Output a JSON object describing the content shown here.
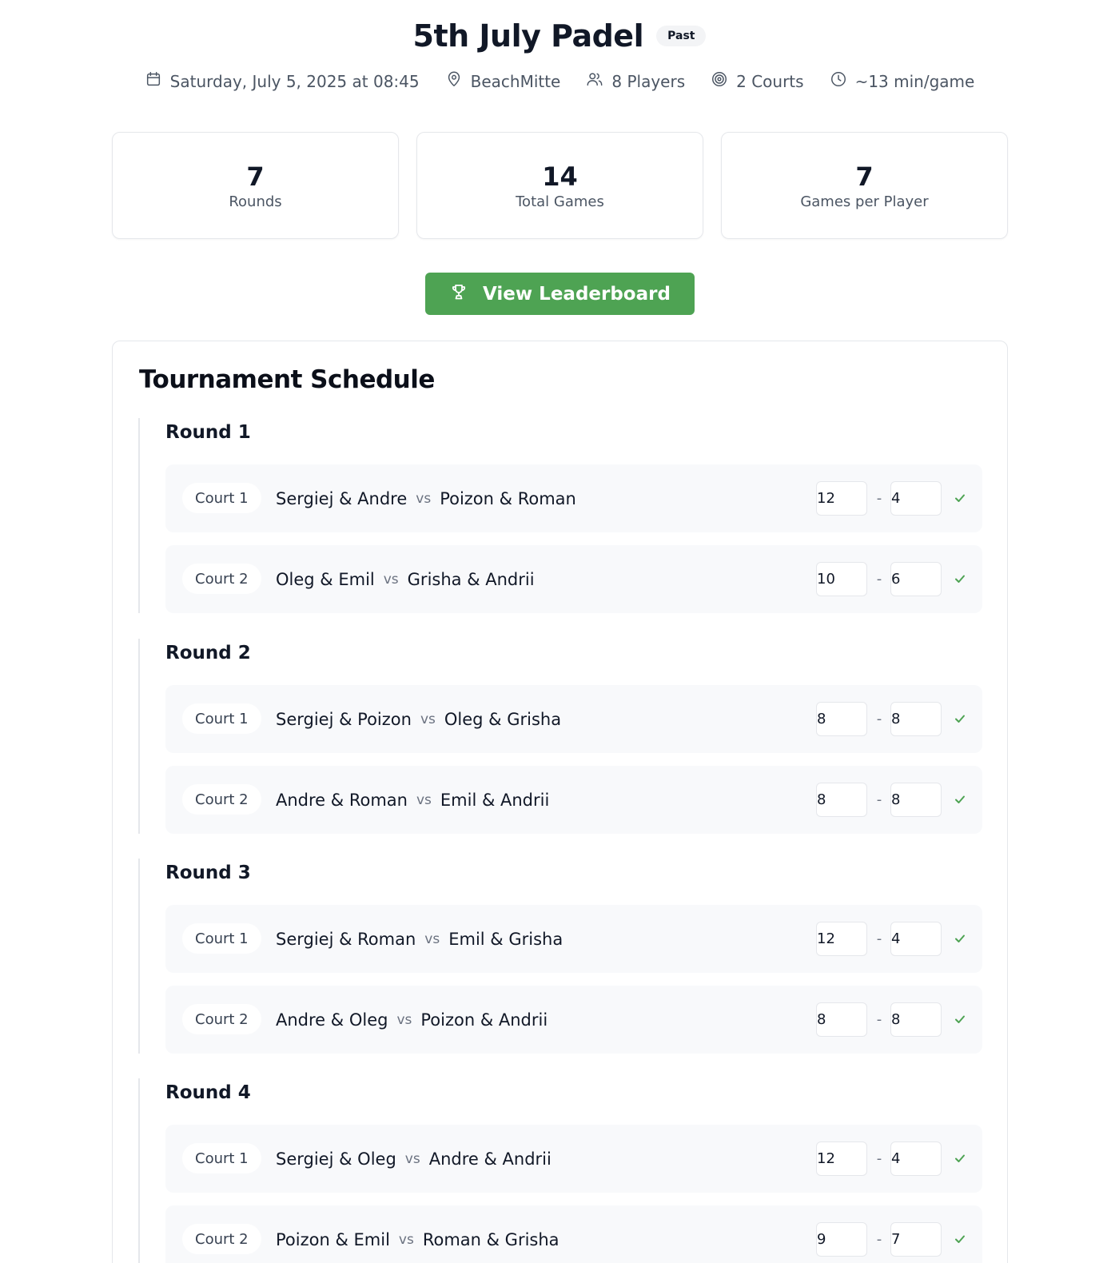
{
  "event": {
    "title": "5th July Padel",
    "status_badge": "Past",
    "date": "Saturday, July 5, 2025 at 08:45",
    "location": "BeachMitte",
    "players": "8 Players",
    "courts": "2 Courts",
    "duration": "~13 min/game"
  },
  "stats": [
    {
      "value": "7",
      "label": "Rounds"
    },
    {
      "value": "14",
      "label": "Total Games"
    },
    {
      "value": "7",
      "label": "Games per Player"
    }
  ],
  "leaderboard_button": "View Leaderboard",
  "schedule": {
    "title": "Tournament Schedule",
    "vs_label": "vs",
    "score_separator": "-",
    "rounds": [
      {
        "title": "Round 1",
        "matches": [
          {
            "court": "Court 1",
            "team_a": "Sergiej & Andre",
            "team_b": "Poizon & Roman",
            "score_a": "12",
            "score_b": "4"
          },
          {
            "court": "Court 2",
            "team_a": "Oleg & Emil",
            "team_b": "Grisha & Andrii",
            "score_a": "10",
            "score_b": "6"
          }
        ]
      },
      {
        "title": "Round 2",
        "matches": [
          {
            "court": "Court 1",
            "team_a": "Sergiej & Poizon",
            "team_b": "Oleg & Grisha",
            "score_a": "8",
            "score_b": "8"
          },
          {
            "court": "Court 2",
            "team_a": "Andre & Roman",
            "team_b": "Emil & Andrii",
            "score_a": "8",
            "score_b": "8"
          }
        ]
      },
      {
        "title": "Round 3",
        "matches": [
          {
            "court": "Court 1",
            "team_a": "Sergiej & Roman",
            "team_b": "Emil & Grisha",
            "score_a": "12",
            "score_b": "4"
          },
          {
            "court": "Court 2",
            "team_a": "Andre & Oleg",
            "team_b": "Poizon & Andrii",
            "score_a": "8",
            "score_b": "8"
          }
        ]
      },
      {
        "title": "Round 4",
        "matches": [
          {
            "court": "Court 1",
            "team_a": "Sergiej & Oleg",
            "team_b": "Andre & Andrii",
            "score_a": "12",
            "score_b": "4"
          },
          {
            "court": "Court 2",
            "team_a": "Poizon & Emil",
            "team_b": "Roman & Grisha",
            "score_a": "9",
            "score_b": "7"
          }
        ]
      }
    ]
  },
  "colors": {
    "accent_green": "#4ea353",
    "match_bg": "#f8f9fb",
    "border": "#e5e7eb"
  },
  "icons": [
    "calendar-icon",
    "location-pin-icon",
    "users-icon",
    "target-icon",
    "clock-icon",
    "trophy-icon",
    "check-icon"
  ]
}
